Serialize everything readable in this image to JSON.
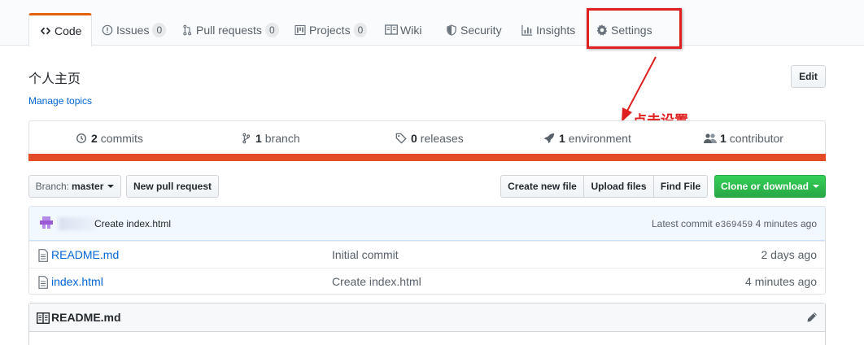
{
  "nav": {
    "tabs": [
      {
        "label": "Code",
        "icon": "code-icon"
      },
      {
        "label": "Issues",
        "count": "0",
        "icon": "issue-opened-icon"
      },
      {
        "label": "Pull requests",
        "count": "0",
        "icon": "git-pull-request-icon"
      },
      {
        "label": "Projects",
        "count": "0",
        "icon": "project-icon"
      },
      {
        "label": "Wiki",
        "icon": "book-icon"
      },
      {
        "label": "Security",
        "icon": "shield-icon"
      },
      {
        "label": "Insights",
        "icon": "graph-icon"
      },
      {
        "label": "Settings",
        "icon": "gear-icon"
      }
    ]
  },
  "repo": {
    "description": "个人主页",
    "manage_topics": "Manage topics",
    "edit_label": "Edit"
  },
  "annotation": {
    "text": "点击设置",
    "color": "#e02020"
  },
  "summary": {
    "commits": {
      "count": "2",
      "label": "commits"
    },
    "branches": {
      "count": "1",
      "label": "branch"
    },
    "releases": {
      "count": "0",
      "label": "releases"
    },
    "environments": {
      "count": "1",
      "label": "environment"
    },
    "contributors": {
      "count": "1",
      "label": "contributor"
    },
    "language_color": "#e34c26"
  },
  "file_nav": {
    "branch_prefix": "Branch:",
    "branch_name": "master",
    "new_pull_request": "New pull request",
    "create_new_file": "Create new file",
    "upload_files": "Upload files",
    "find_file": "Find File",
    "clone_or_download": "Clone or download"
  },
  "commit_tease": {
    "message": "Create index.html",
    "latest_label": "Latest commit",
    "sha": "e369459",
    "age": "4 minutes ago"
  },
  "files": [
    {
      "name": "README.md",
      "message": "Initial commit",
      "age": "2 days ago"
    },
    {
      "name": "index.html",
      "message": "Create index.html",
      "age": "4 minutes ago"
    }
  ],
  "readme": {
    "title": "README.md"
  }
}
